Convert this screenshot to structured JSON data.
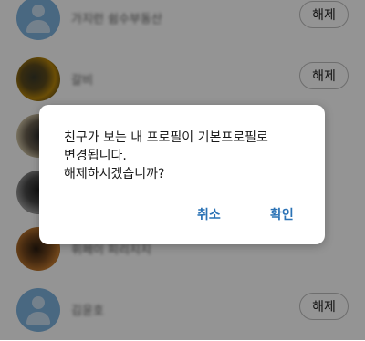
{
  "list": {
    "rows": [
      {
        "name": "가지런 쉼수부동산",
        "avatar": "default-avatar",
        "button": "해제"
      },
      {
        "name": "갈비",
        "avatar": "photo",
        "button": "해제"
      },
      {
        "name": "",
        "avatar": "photo",
        "button": ""
      },
      {
        "name": "",
        "avatar": "photo",
        "button": ""
      },
      {
        "name": "휘페이 피리지지",
        "avatar": "photo",
        "button": ""
      },
      {
        "name": "김윤호",
        "avatar": "default-avatar",
        "button": "해제"
      }
    ]
  },
  "dialog": {
    "message_line1": "친구가 보는 내 프로필이 기본프로필로",
    "message_line2": "변경됩니다.",
    "message_line3": "해제하시겠습니까?",
    "cancel_label": "취소",
    "confirm_label": "확인"
  },
  "colors": {
    "accent": "#2a72b5",
    "overlay": "rgba(0,0,0,0.42)",
    "default_avatar": "#7fb3df"
  }
}
